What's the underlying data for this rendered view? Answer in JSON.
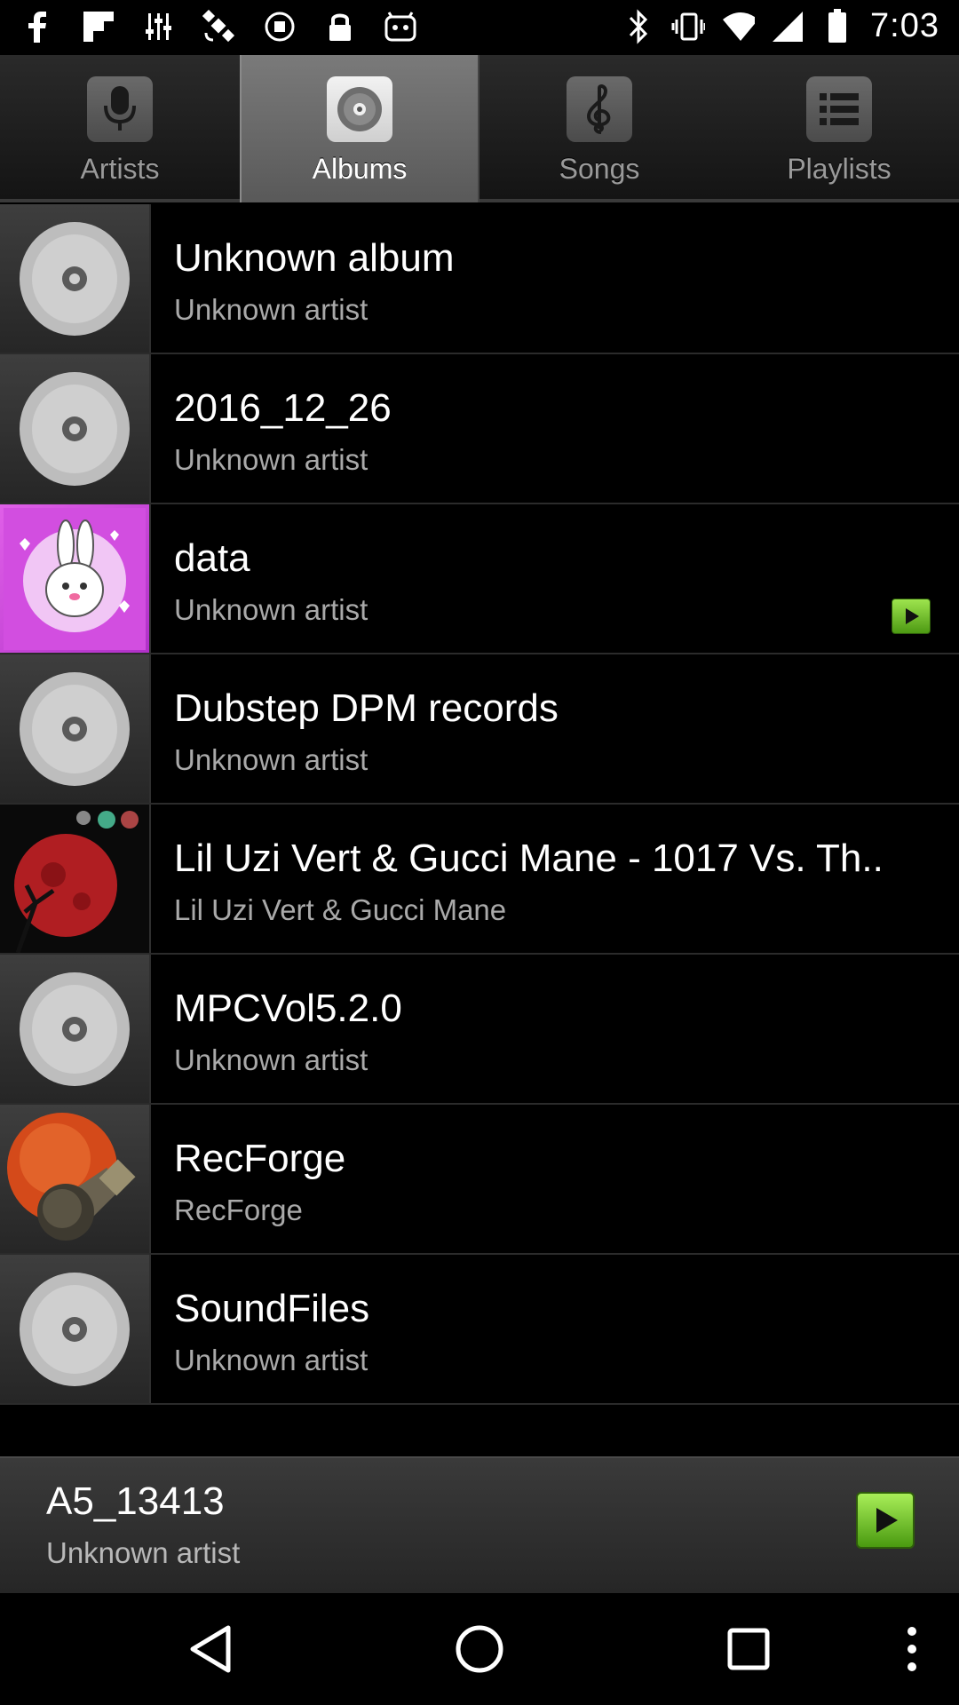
{
  "status_bar": {
    "left_icons": [
      "facebook-icon",
      "flipboard-icon",
      "equalizer-icon",
      "satellite-icon",
      "circle-stop-icon",
      "lock-icon",
      "android-icon"
    ],
    "right_icons": [
      "bluetooth-icon",
      "vibrate-icon",
      "wifi-icon",
      "signal-icon",
      "battery-icon"
    ],
    "time": "7:03"
  },
  "tabs": [
    {
      "label": "Artists",
      "icon": "microphone-icon",
      "active": false
    },
    {
      "label": "Albums",
      "icon": "disc-icon",
      "active": true
    },
    {
      "label": "Songs",
      "icon": "treble-clef-icon",
      "active": false
    },
    {
      "label": "Playlists",
      "icon": "list-icon",
      "active": false
    }
  ],
  "albums": [
    {
      "title": "Unknown album",
      "artist": "Unknown artist",
      "art": "disc-placeholder"
    },
    {
      "title": "2016_12_26",
      "artist": "Unknown artist",
      "art": "disc-placeholder"
    },
    {
      "title": "data",
      "artist": "Unknown artist",
      "art": "bunny-art",
      "playing": true
    },
    {
      "title": "Dubstep DPM records",
      "artist": "Unknown artist",
      "art": "disc-placeholder"
    },
    {
      "title": "Lil Uzi Vert & Gucci Mane - 1017 Vs. Th..",
      "artist": "Lil Uzi Vert & Gucci Mane",
      "art": "red-moon-art"
    },
    {
      "title": "MPCVol5.2.0",
      "artist": "Unknown artist",
      "art": "disc-placeholder"
    },
    {
      "title": "RecForge",
      "artist": "RecForge",
      "art": "recforge-microphone-art"
    },
    {
      "title": "SoundFiles",
      "artist": "Unknown artist",
      "art": "disc-placeholder"
    }
  ],
  "now_playing": {
    "title": "A5_13413",
    "artist": "Unknown artist"
  },
  "colors": {
    "accent_green": "#6cc12a",
    "background": "#000000",
    "subtitle_gray": "#a9a9a9"
  }
}
